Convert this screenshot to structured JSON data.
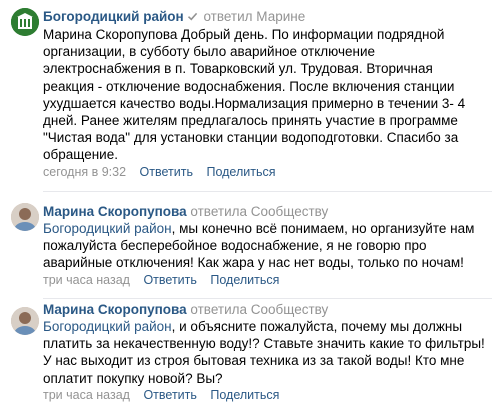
{
  "comments": [
    {
      "author": "Богородицкий район",
      "action": "ответил",
      "reply_to": "Марине",
      "mention": "",
      "text": "Марина Скоропупова Добрый день. По информации подрядной организации, в субботу было аварийное отключение электроснабжения в п. Товарковский ул. Трудовая. Вторичная реакция - отключение водоснабжения. После включения станции ухудшается качество воды.Нормализация примерно в течении 3- 4 дней. Ранее жителям предлагалось принять участие в программе \"Чистая вода\" для установки станции водоподготовки. Спасибо за обращение.",
      "time": "сегодня в 9:32",
      "reply_label": "Ответить",
      "share_label": "Поделиться"
    },
    {
      "author": "Марина Скоропупова",
      "action": "ответила",
      "reply_to": "Сообществу",
      "mention": "Богородицкий район",
      "text": ", мы конечно всё понимаем, но организуйте нам пожалуйста бесперебойное водоснабжение, я не говорю про аварийные отключения! Как жара у нас нет воды, только по ночам!",
      "time": "три часа назад",
      "reply_label": "Ответить",
      "share_label": "Поделиться"
    },
    {
      "author": "Марина Скоропупова",
      "action": "ответила",
      "reply_to": "Сообществу",
      "mention": "Богородицкий район",
      "text": ", и объясните пожалуйста, почему мы должны платить за некачественную воду!? Ставьте значить какие то фильтры! У нас выходит из строя бытовая техника из за такой воды! Кто мне оплатит покупку новой? Вы?",
      "time": "три часа назад",
      "reply_label": "Ответить",
      "share_label": "Поделиться"
    }
  ],
  "colors": {
    "link": "#2a5885",
    "meta": "#939393",
    "divider": "#e7e8ec"
  },
  "icons": {
    "verified": "verified-check-icon"
  }
}
